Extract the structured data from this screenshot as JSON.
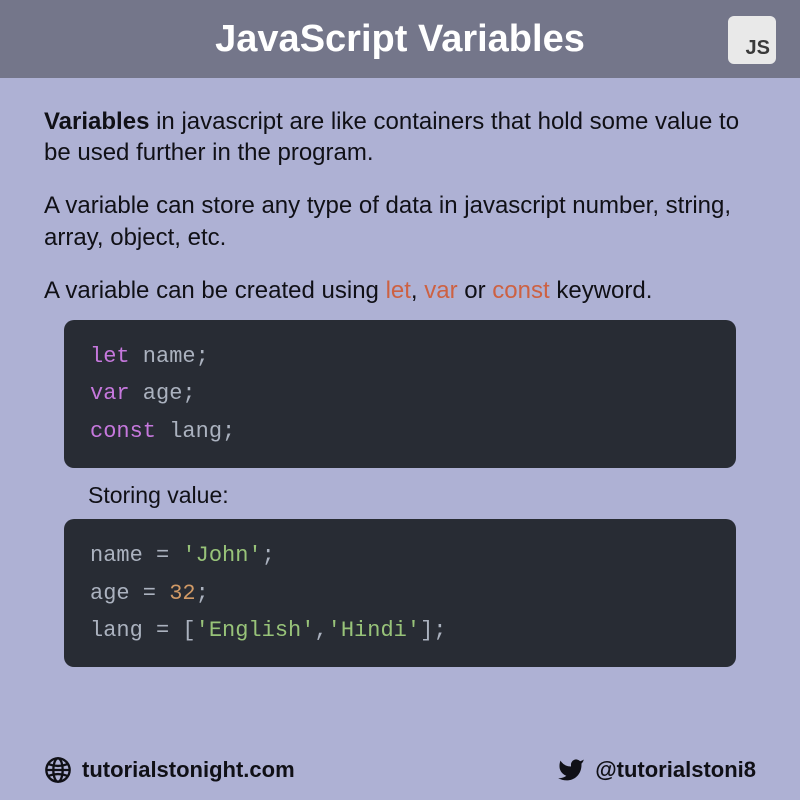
{
  "header": {
    "title": "JavaScript Variables",
    "badge": "JS"
  },
  "paragraphs": {
    "p1_bold": "Variables",
    "p1_rest": " in javascript are like containers that hold some value to be used further in the program.",
    "p2": "A variable can store any type of data in javascript number, string, array, object, etc.",
    "p3_pre": "A variable can be created using ",
    "p3_kw1": "let",
    "p3_sep1": ", ",
    "p3_kw2": "var",
    "p3_sep2": " or ",
    "p3_kw3": "const",
    "p3_post": " keyword."
  },
  "code1": {
    "l1_kw": "let",
    "l1_ident": " name",
    "l1_end": ";",
    "l2_kw": "var",
    "l2_ident": " age",
    "l2_end": ";",
    "l3_kw": "const",
    "l3_ident": " lang",
    "l3_end": ";"
  },
  "subheading": "Storing value:",
  "code2": {
    "l1_ident": "name = ",
    "l1_str": "'John'",
    "l1_end": ";",
    "l2_ident": "age = ",
    "l2_num": "32",
    "l2_end": ";",
    "l3_ident": "lang = [",
    "l3_str1": "'English'",
    "l3_sep": ",",
    "l3_str2": "'Hindi'",
    "l3_end": "];"
  },
  "footer": {
    "site": "tutorialstonight.com",
    "handle": "@tutorialstoni8"
  }
}
